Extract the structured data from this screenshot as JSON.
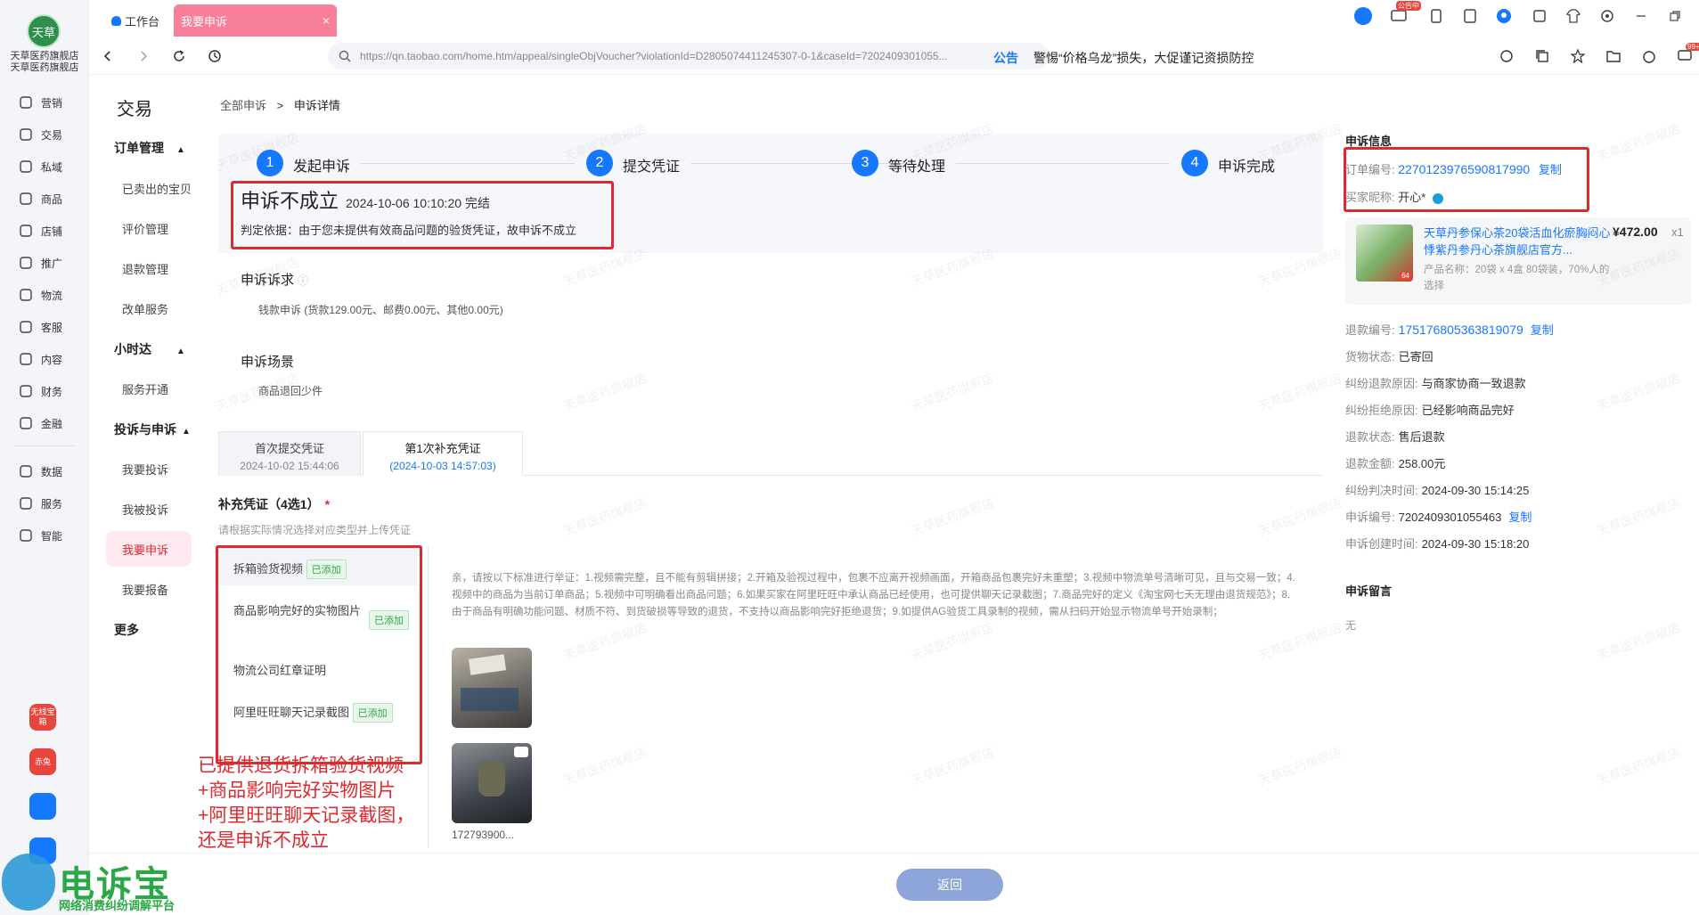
{
  "shop": {
    "logo_text": "天草",
    "name_line1": "天草医药旗舰店",
    "name_line2": "天草医药旗舰店"
  },
  "leftnav": [
    {
      "label": "营销",
      "icon": "megaphone-icon"
    },
    {
      "label": "交易",
      "icon": "receipt-icon"
    },
    {
      "label": "私域",
      "icon": "users-icon"
    },
    {
      "label": "商品",
      "icon": "bag-icon"
    },
    {
      "label": "店铺",
      "icon": "store-icon"
    },
    {
      "label": "推广",
      "icon": "location-icon"
    },
    {
      "label": "物流",
      "icon": "truck-icon"
    },
    {
      "label": "客服",
      "icon": "headset-icon"
    },
    {
      "label": "内容",
      "icon": "grid-icon"
    },
    {
      "label": "财务",
      "icon": "coin-icon"
    },
    {
      "label": "金融",
      "icon": "circle-icon"
    },
    {
      "label": "数据",
      "icon": "chart-icon"
    },
    {
      "label": "服务",
      "icon": "apps-icon"
    },
    {
      "label": "智能",
      "icon": "bolt-icon"
    }
  ],
  "apps": [
    {
      "label": "无线宝箱",
      "color": "#e8453c"
    },
    {
      "label": "赤兔",
      "color": "#e8453c"
    },
    {
      "label": "",
      "color": "#1677ff"
    },
    {
      "label": "",
      "color": "#1677ff"
    }
  ],
  "tabs": {
    "workbench": "工作台",
    "active": "我要申诉",
    "close": "×"
  },
  "topicons": {
    "notify_badge": "公告中",
    "msg_badge": "99+"
  },
  "address": {
    "url": "https://qn.taobao.com/home.htm/appeal/singleObjVoucher?violationId=D2805074411245307-0-1&caseId=7202409301055...",
    "notice_label": "公告",
    "notice_text": "警惕“价格乌龙”损失，大促谨记资损防控"
  },
  "subnav": {
    "title": "交易",
    "groups": [
      {
        "head": "订单管理",
        "items": [
          "已卖出的宝贝",
          "评价管理",
          "退款管理",
          "改单服务"
        ]
      },
      {
        "head": "小时达",
        "items": [
          "服务开通"
        ]
      },
      {
        "head": "投诉与申诉",
        "items": [
          "我要投诉",
          "我被投诉",
          "我要申诉",
          "我要报备"
        ]
      }
    ],
    "more": "更多"
  },
  "breadcrumb": {
    "root": "全部申诉",
    "sep": ">",
    "current": "申诉详情"
  },
  "steps": [
    "发起申诉",
    "提交凭证",
    "等待处理",
    "申诉完成"
  ],
  "step_numbers": [
    "1",
    "2",
    "3",
    "4"
  ],
  "result": {
    "title": "申诉不成立",
    "time": "2024-10-06 10:10:20 完结",
    "basis": "判定依据：由于您未提供有效商品问题的验货凭证，故申诉不成立"
  },
  "claim": {
    "title": "申诉诉求",
    "detail": "钱款申诉 (货款129.00元、邮费0.00元、其他0.00元)"
  },
  "scene": {
    "title": "申诉场景",
    "detail": "商品退回少件"
  },
  "evidence_tabs": [
    {
      "label": "首次提交凭证",
      "time": "2024-10-02 15:44:06"
    },
    {
      "label": "第1次补充凭证",
      "time": "(2024-10-03 14:57:03)"
    }
  ],
  "supplement": {
    "title": "补充凭证（4选1）",
    "required": "*",
    "hint": "请根据实际情况选择对应类型并上传凭证",
    "options": [
      {
        "label": "拆箱验货视频",
        "badge": "已添加"
      },
      {
        "label": "商品影响完好的实物图片",
        "badge": "已添加"
      },
      {
        "label": "物流公司红章证明",
        "badge": ""
      },
      {
        "label": "阿里旺旺聊天记录截图",
        "badge": "已添加"
      }
    ],
    "standard": "亲，请按以下标准进行举证：1.视频需完整，且不能有剪辑拼接；2.开箱及验视过程中，包裹不应离开视频画面，开箱商品包裹完好未重塑；3.视频中物流单号清晰可见，且与交易一致；4.视频中的商品为当前订单商品；5.视频中可明确看出商品问题；6.如果买家在阿里旺旺中承认商品已经使用，也可提供聊天记录截图；7.商品完好的定义《淘宝网七天无理由退货规范》；8.由于商品有明确功能问题、材质不符、到货破损等导致的退货，不支持以商品影响完好拒绝退货；9.如提供AG验货工具录制的视频，需从扫码开始显示物流单号开始录制；",
    "video_name": "172793900..."
  },
  "annotation": [
    "已提供退货拆箱验货视频",
    "+商品影响完好实物图片",
    "+阿里旺旺聊天记录截图，",
    "还是申诉不成立"
  ],
  "info": {
    "title": "申诉信息",
    "order_label": "订单编号:",
    "order_no": "2270123976590817990",
    "copy": "复制",
    "buyer_label": "买家昵称:",
    "buyer": "开心*",
    "product": {
      "name": "天草丹参保心茶20袋活血化瘀胸闷心悸紫丹参丹心茶旗舰店官方...",
      "price": "¥472.00",
      "qty": "x1",
      "spec": "产品名称：20袋 x 4盒 80袋装，70%人的选择",
      "thumb_tag": "64"
    },
    "rows": [
      {
        "label": "退款编号:",
        "value": "175176805363819079",
        "link": true,
        "copy": "复制"
      },
      {
        "label": "货物状态:",
        "value": "已寄回"
      },
      {
        "label": "纠纷退款原因:",
        "value": "与商家协商一致退款"
      },
      {
        "label": "纠纷拒绝原因:",
        "value": "已经影响商品完好"
      },
      {
        "label": "退款状态:",
        "value": "售后退款"
      },
      {
        "label": "退款金额:",
        "value": "258.00元"
      },
      {
        "label": "纠纷判决时间:",
        "value": "2024-09-30 15:14:25"
      },
      {
        "label": "申诉编号:",
        "value": "7202409301055463",
        "copy": "复制"
      },
      {
        "label": "申诉创建时间:",
        "value": "2024-09-30 15:18:20"
      }
    ],
    "message_title": "申诉留言",
    "message": "无"
  },
  "footer": {
    "back": "返回"
  },
  "brand": {
    "name": "电诉宝",
    "sub": "网络消费纠纷调解平台"
  },
  "watermark": "天草医药旗舰店",
  "colors": {
    "accent": "#1677ff",
    "annotation_red": "#e0282e",
    "success": "#2aa846"
  }
}
